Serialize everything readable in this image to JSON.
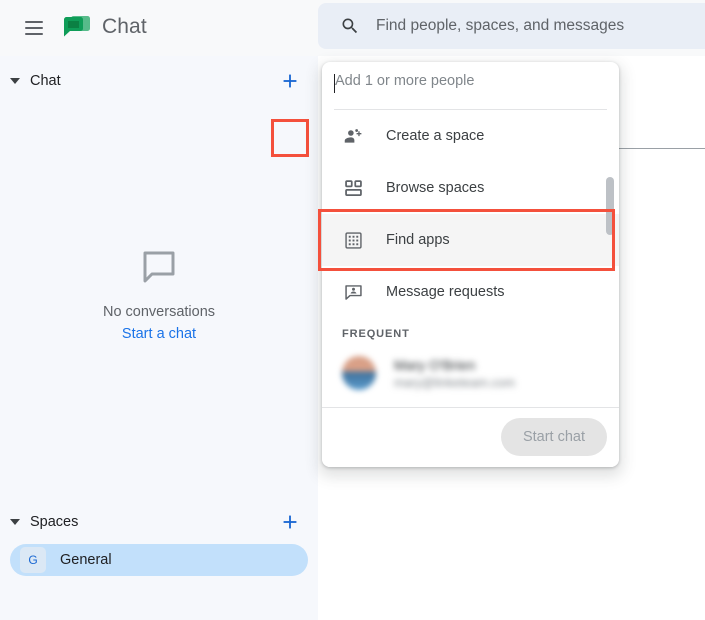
{
  "app": {
    "title": "Chat",
    "logo_icon": "google-chat-logo",
    "menu_icon": "hamburger-menu-icon"
  },
  "search": {
    "icon": "search-icon",
    "placeholder": "Find people, spaces, and messages",
    "value": ""
  },
  "sidebar": {
    "chat_section": {
      "label": "Chat",
      "caret_icon": "caret-down-icon",
      "add_icon": "plus-icon"
    },
    "empty_state": {
      "icon": "chat-bubble-outline-icon",
      "text": "No conversations",
      "link": "Start a chat"
    },
    "spaces_section": {
      "label": "Spaces",
      "caret_icon": "caret-down-icon",
      "add_icon": "plus-icon"
    },
    "spaces": [
      {
        "initial": "G",
        "name": "General"
      }
    ]
  },
  "dropdown": {
    "input": {
      "placeholder": "Add 1 or more people",
      "value": ""
    },
    "items": [
      {
        "label": "Create a space",
        "icon": "group-add-icon",
        "selected": false
      },
      {
        "label": "Browse spaces",
        "icon": "browse-spaces-icon",
        "selected": false
      },
      {
        "label": "Find apps",
        "icon": "apps-grid-icon",
        "selected": true
      },
      {
        "label": "Message requests",
        "icon": "message-request-icon",
        "selected": false
      }
    ],
    "group_title": "FREQUENT",
    "people": [
      {
        "name": "",
        "email": ""
      }
    ],
    "footer": {
      "start_chat_label": "Start chat"
    },
    "scrollbar": "vertical-scrollbar"
  },
  "colors": {
    "highlight": "#f4503c",
    "accent_blue": "#1a73e8",
    "brand_green": "#188038",
    "sidebar_bg": "#f6f8fc",
    "search_bg": "#e9eef6",
    "space_selected": "#c2e0fb"
  }
}
